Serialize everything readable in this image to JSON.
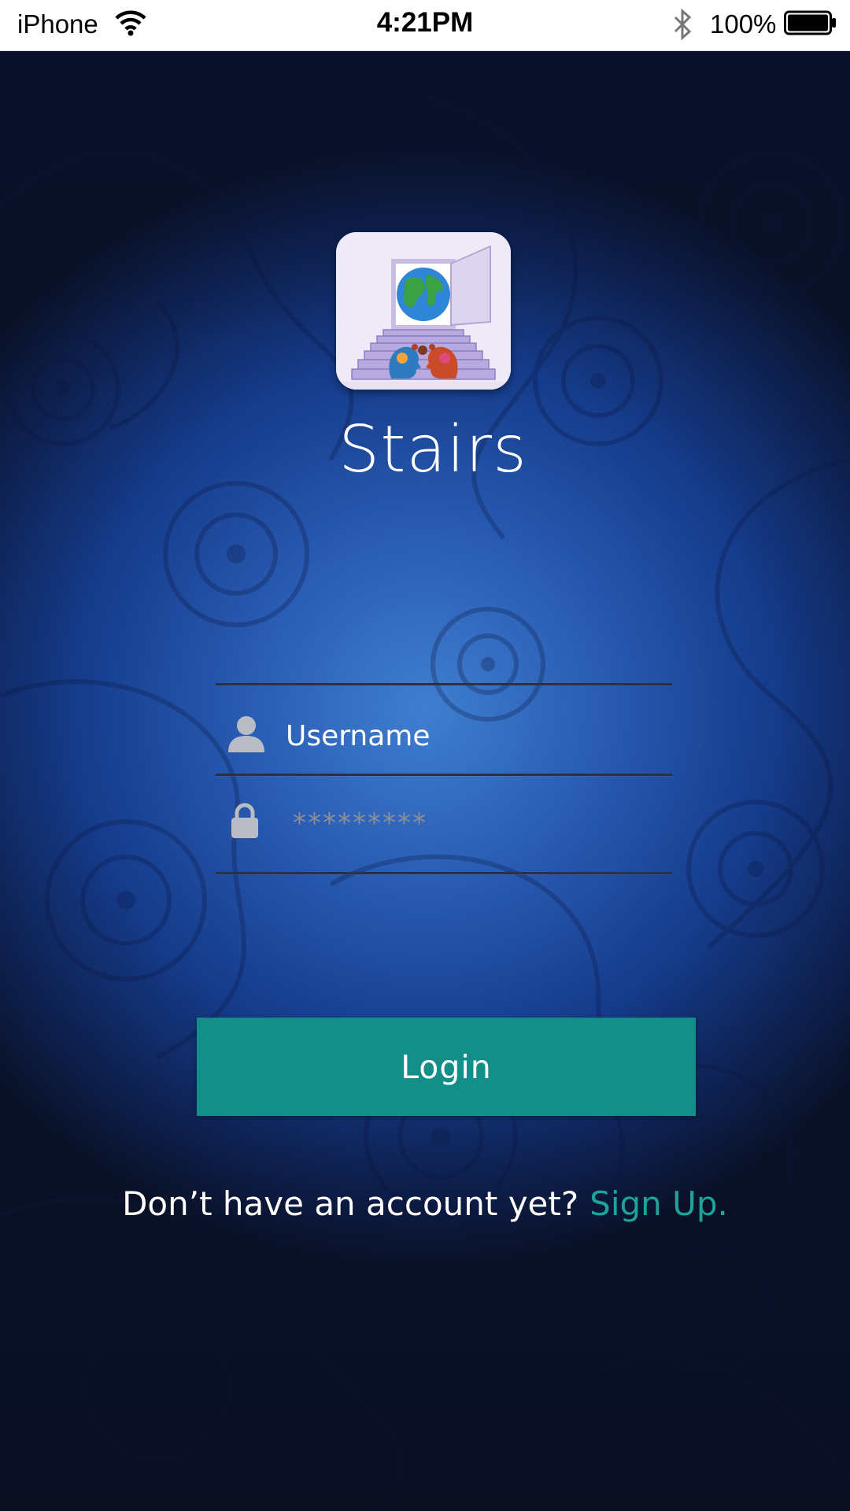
{
  "status_bar": {
    "carrier": "iPhone",
    "time": "4:21PM",
    "battery": "100%",
    "icons": [
      "wifi-icon",
      "bluetooth-icon",
      "battery-icon"
    ]
  },
  "app": {
    "title": "Stairs",
    "logo_icon": "stairs-globe-logo-icon"
  },
  "login_form": {
    "username_placeholder": "Username",
    "password_placeholder": "*********",
    "username_icon": "user-icon",
    "password_icon": "lock-icon",
    "login_label": "Login"
  },
  "signup": {
    "prompt": "Don’t have an account yet?",
    "link_label": "Sign Up."
  },
  "colors": {
    "accent": "#138e88",
    "link": "#1ea39a",
    "background": "#1b4fa3"
  }
}
